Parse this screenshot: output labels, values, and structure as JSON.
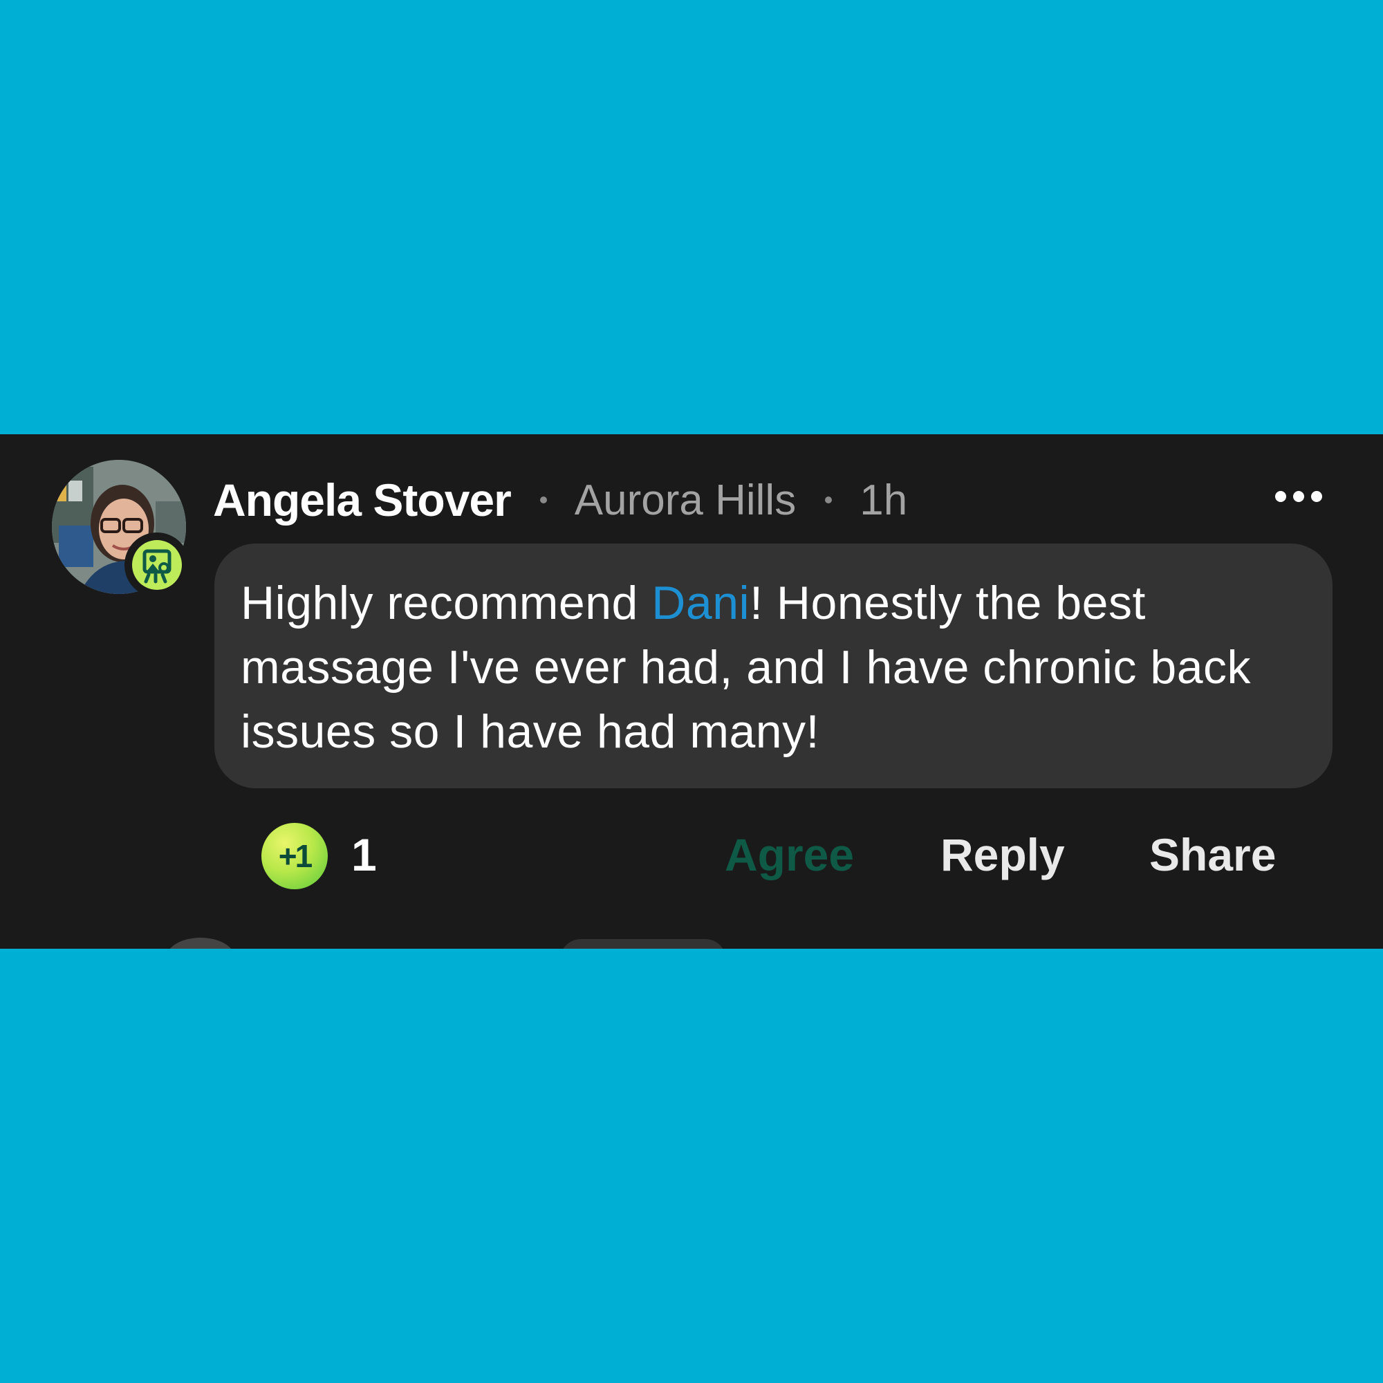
{
  "comment": {
    "author": "Angela Stover",
    "neighborhood": "Aurora Hills",
    "time": "1h",
    "text_before_mention": "Highly recommend ",
    "mention": "Dani",
    "text_after_mention": "! Honestly the best massage I've ever had, and I have chronic back issues so I have had many!"
  },
  "reactions": {
    "badge_label": "+1",
    "count": "1"
  },
  "actions": {
    "agree_label": "Agree",
    "reply_label": "Reply",
    "share_label": "Share"
  },
  "icons": {
    "avatar_badge": "helper-badge-icon",
    "more": "more-options-icon"
  },
  "colors": {
    "background": "#00AFD4",
    "card": "#1a1a1a",
    "bubble": "#333333",
    "mention": "#1d8fd3",
    "agree": "#0f5a46",
    "badge": "#bdeb5a"
  }
}
